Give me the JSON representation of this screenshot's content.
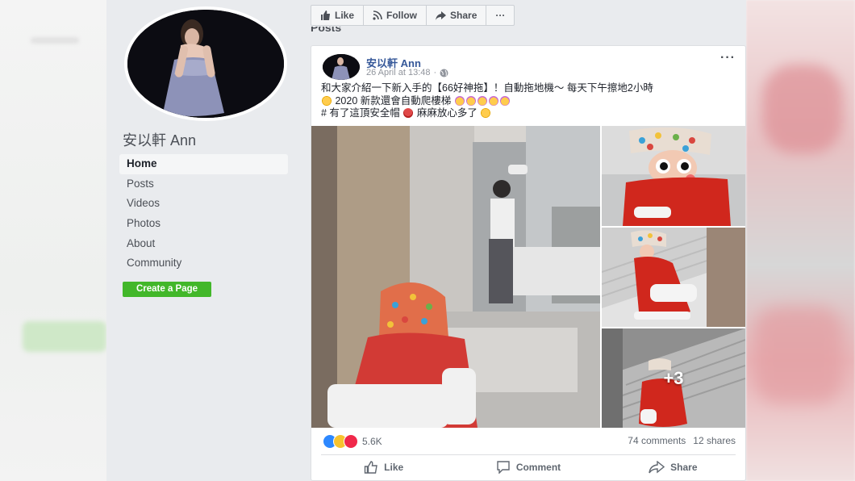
{
  "page": {
    "name": "安以軒 Ann",
    "nav": [
      {
        "label": "Home",
        "active": true
      },
      {
        "label": "Posts"
      },
      {
        "label": "Videos"
      },
      {
        "label": "Photos"
      },
      {
        "label": "About"
      },
      {
        "label": "Community"
      }
    ],
    "create_page_label": "Create a Page"
  },
  "actionbar": {
    "like_label": "Like",
    "follow_label": "Follow",
    "share_label": "Share",
    "more_label": "···"
  },
  "posts_heading": "Posts",
  "post": {
    "author": "安以軒 Ann",
    "timestamp": "26 April at 13:48",
    "privacy_icon": "globe-icon",
    "more_label": "···",
    "line1": "和大家介紹一下新入手的【66好神拖】！自動拖地機～ 每天下午擦地2小時",
    "line2": "2020 新款還會自動爬樓梯",
    "line3_a": "# 有了這頂安全帽",
    "line3_b": "麻麻放心多了",
    "extra_photos_label": "+3",
    "reactions_count": "5.6K",
    "comments": "74 comments",
    "shares": "12 shares",
    "like_label": "Like",
    "comment_label": "Comment",
    "share_label": "Share"
  },
  "colors": {
    "link": "#365899",
    "create_page_green": "#42b72a",
    "background": "#e9ebee",
    "like_reaction": "#2d88ff",
    "love_reaction": "#f0284a",
    "haha_reaction": "#f7c32f"
  }
}
